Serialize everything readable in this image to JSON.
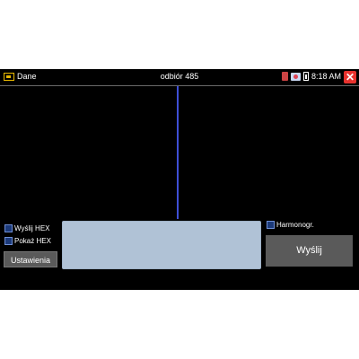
{
  "topbar": {
    "left_title": "Dane",
    "center_title": "odbiór 485",
    "time": "8:18 AM",
    "icons": [
      "folder-icon",
      "sd-card-icon",
      "usb-icon",
      "battery-icon",
      "close-icon"
    ]
  },
  "options": {
    "send_hex_label": "Wyślij HEX",
    "show_hex_label": "Pokaż HEX",
    "harmonogram_label": "Harmonogr."
  },
  "buttons": {
    "settings_label": "Ustawienia",
    "send_label": "Wyślij",
    "close_glyph": "✕"
  },
  "input": {
    "value": ""
  },
  "colors": {
    "background": "#000000",
    "cursor": "#3e4fd6",
    "input": "#b0c2d6",
    "button": "#5a5a5a",
    "close": "#e8322e"
  }
}
